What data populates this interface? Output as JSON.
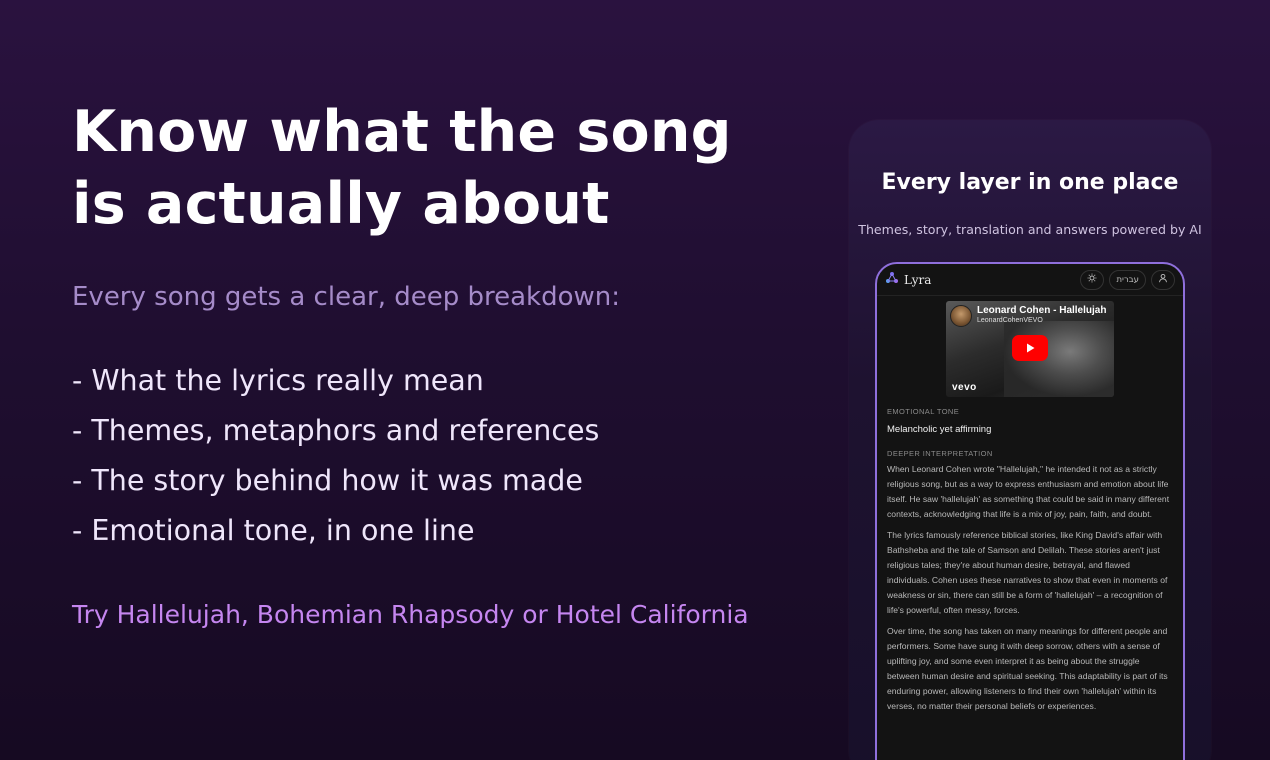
{
  "hero": {
    "headline_line1": "Know what the song",
    "headline_line2": "is actually about",
    "subhead": "Every song gets a clear, deep breakdown:",
    "bullets": [
      "- What the lyrics really mean",
      "- Themes, metaphors and references",
      "- The story behind how it was made",
      "- Emotional tone, in one line"
    ],
    "cta": "Try Hallelujah, Bohemian Rhapsody or Hotel California"
  },
  "card": {
    "title": "Every layer in one place",
    "subtitle": "Themes, story, translation and answers powered by AI"
  },
  "app": {
    "name": "Lyra",
    "language_toggle": "עברית",
    "video": {
      "title": "Leonard Cohen - Hallelujah",
      "channel": "LeonardCohenVEVO",
      "watermark": "vevo"
    },
    "emotional_tone_label": "EMOTIONAL TONE",
    "emotional_tone_value": "Melancholic yet affirming",
    "deeper_label": "DEEPER INTERPRETATION",
    "paragraphs": [
      "When Leonard Cohen wrote \"Hallelujah,\" he intended it not as a strictly religious song, but as a way to express enthusiasm and emotion about life itself. He saw 'hallelujah' as something that could be said in many different contexts, acknowledging that life is a mix of joy, pain, faith, and doubt.",
      "The lyrics famously reference biblical stories, like King David's affair with Bathsheba and the tale of Samson and Delilah. These stories aren't just religious tales; they're about human desire, betrayal, and flawed individuals. Cohen uses these narratives to show that even in moments of weakness or sin, there can still be a form of 'hallelujah' – a recognition of life's powerful, often messy, forces.",
      "Over time, the song has taken on many meanings for different people and performers. Some have sung it with deep sorrow, others with a sense of uplifting joy, and some even interpret it as being about the struggle between human desire and spiritual seeking. This adaptability is part of its enduring power, allowing listeners to find their own 'hallelujah' within its verses, no matter their personal beliefs or experiences."
    ]
  },
  "colors": {
    "accent_purple": "#c586f0",
    "subhead_purple": "#a58bc9",
    "phone_border": "#8f6fdc",
    "play_red": "#ff0000"
  }
}
